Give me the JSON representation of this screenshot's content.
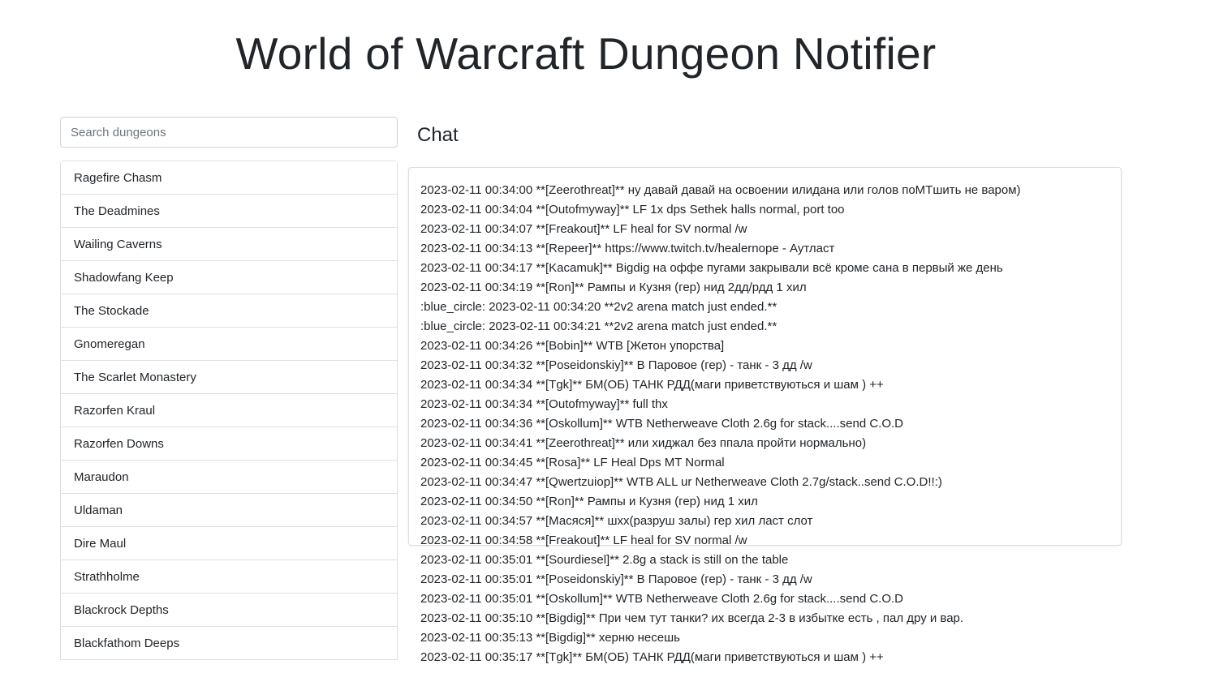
{
  "header": {
    "title": "World of Warcraft Dungeon Notifier"
  },
  "search": {
    "placeholder": "Search dungeons",
    "value": ""
  },
  "dungeons": [
    "Ragefire Chasm",
    "The Deadmines",
    "Wailing Caverns",
    "Shadowfang Keep",
    "The Stockade",
    "Gnomeregan",
    "The Scarlet Monastery",
    "Razorfen Kraul",
    "Razorfen Downs",
    "Maraudon",
    "Uldaman",
    "Dire Maul",
    "Strathholme",
    "Blackrock Depths",
    "Blackfathom Deeps"
  ],
  "chat": {
    "heading": "Chat",
    "messages": [
      "2023-02-11 00:34:00 **[Zeerothreat]** ну давай давай на освоении илидана или голов поМТшить не варом)",
      "2023-02-11 00:34:04 **[Outofmyway]** LF 1x dps Sethek halls normal, port too",
      "2023-02-11 00:34:07 **[Freakout]** LF heal for SV normal /w",
      "2023-02-11 00:34:13 **[Repeer]** https://www.twitch.tv/healernope - Аутласт",
      "2023-02-11 00:34:17 **[Kacamuk]** Bigdig на оффе пугами закрывали всё кроме сана в первый же день",
      "2023-02-11 00:34:19 **[Ron]** Рампы и Кузня (гер) нид 2дд/рдд 1 хил",
      ":blue_circle: 2023-02-11 00:34:20 **2v2 arena match just ended.**",
      ":blue_circle: 2023-02-11 00:34:21 **2v2 arena match just ended.**",
      "2023-02-11 00:34:26 **[Bobin]** WTB [Жетон упорства]",
      "2023-02-11 00:34:32 **[Poseidonskiy]** В Паровое (гер) - танк - 3 дд /w",
      "2023-02-11 00:34:34 **[Tgk]** БМ(ОБ) ТАНК РДД(маги приветствуються и шам ) ++",
      "2023-02-11 00:34:34 **[Outofmyway]** full thx",
      "2023-02-11 00:34:36 **[Oskollum]** WTB Netherweave Cloth 2.6g for stack....send C.O.D",
      "2023-02-11 00:34:41 **[Zeerothreat]** или хиджал без ппала пройти нормально)",
      "2023-02-11 00:34:45 **[Rosa]** LF Heal Dps MT Normal",
      "2023-02-11 00:34:47 **[Qwertzuiop]** WTB ALL ur Netherweave Cloth 2.7g/stack..send C.O.D!!:)",
      "2023-02-11 00:34:50 **[Ron]** Рампы и Кузня (гер) нид 1 хил",
      "2023-02-11 00:34:57 **[Масяся]** шхх(разруш залы) гер хил ласт слот",
      "2023-02-11 00:34:58 **[Freakout]** LF heal for SV normal /w",
      "2023-02-11 00:35:01 **[Sourdiesel]** 2.8g a stack is still on the table",
      "2023-02-11 00:35:01 **[Poseidonskiy]** В Паровое (гер) - танк - 3 дд /w",
      "2023-02-11 00:35:01 **[Oskollum]** WTB Netherweave Cloth 2.6g for stack....send C.O.D",
      "2023-02-11 00:35:10 **[Bigdig]** При чем тут танки? их всегда 2-3 в избытке есть , пал дру и вар.",
      "2023-02-11 00:35:13 **[Bigdig]** херню несешь",
      "2023-02-11 00:35:17 **[Tgk]** БМ(ОБ) ТАНК РДД(маги приветствуються и шам ) ++"
    ]
  }
}
